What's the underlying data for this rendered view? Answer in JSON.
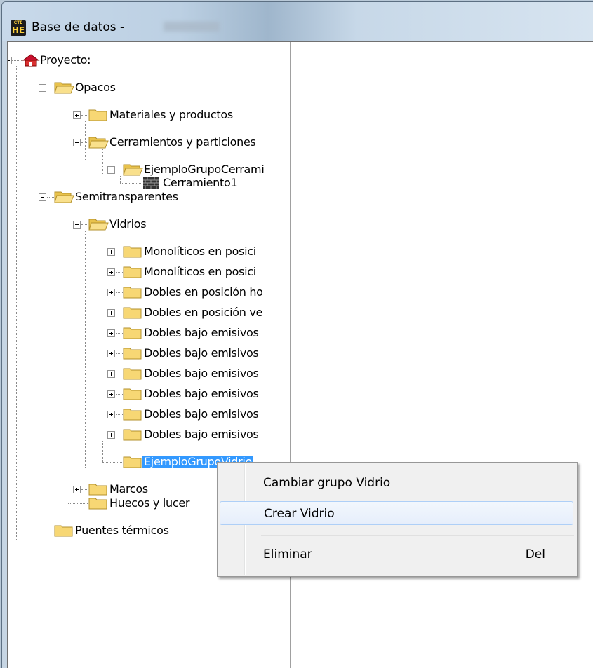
{
  "window": {
    "title": "Base de datos -",
    "app_icon_top": "CTE",
    "app_icon_main": "HE"
  },
  "tree": {
    "root": "Proyecto:",
    "opacos": "Opacos",
    "materiales": "Materiales y productos",
    "cerramientos": "Cerramientos y particiones",
    "grupo_cerram": "EjemploGrupoCerrami",
    "cerramiento1": "Cerramiento1",
    "semitransparentes": "Semitransparentes",
    "vidrios": "Vidrios",
    "vidrio_groups": [
      "Monolíticos en posici",
      "Monolíticos en posici",
      "Dobles en posición ho",
      "Dobles en posición ve",
      "Dobles bajo emisivos",
      "Dobles bajo emisivos",
      "Dobles bajo emisivos",
      "Dobles bajo emisivos",
      "Dobles bajo emisivos",
      "Dobles bajo emisivos"
    ],
    "grupo_vidrio": "EjemploGrupoVidrio",
    "marcos": "Marcos",
    "huecos": "Huecos y lucer",
    "puentes": "Puentes térmicos"
  },
  "context_menu": {
    "items": [
      {
        "label": "Cambiar grupo Vidrio",
        "shortcut": ""
      },
      {
        "label": "Crear Vidrio",
        "shortcut": ""
      },
      {
        "label": "Eliminar",
        "shortcut": "Del"
      }
    ],
    "highlighted_index": 1
  },
  "colors": {
    "selection": "#3399ff",
    "folder": "#f7d774"
  }
}
